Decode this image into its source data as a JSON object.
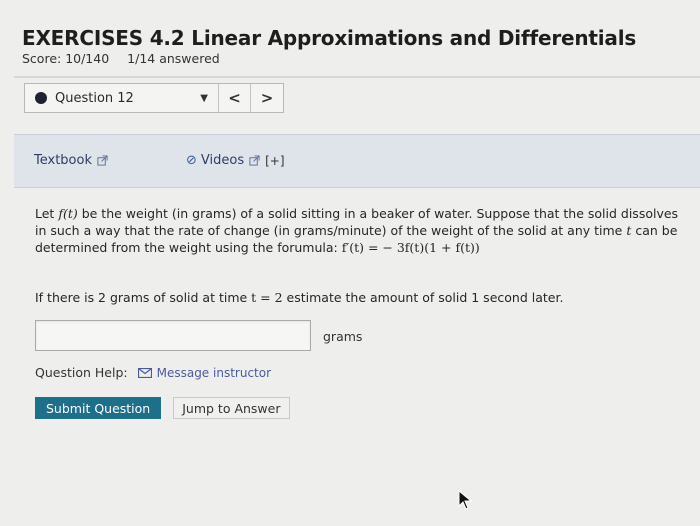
{
  "header": {
    "title": "EXERCISES 4.2 Linear Approximations and Differentials",
    "score": "Score: 10/140",
    "answered": "1/14 answered"
  },
  "question_nav": {
    "selected": "Question 12",
    "prev_label": "<",
    "next_label": ">"
  },
  "resources": {
    "textbook_label": "Textbook",
    "videos_label": "Videos",
    "expand_label": "[+]"
  },
  "problem": {
    "part1": "Let ",
    "fn": "f(t)",
    "part2": " be the weight (in grams) of a solid sitting in a beaker of water. Suppose that the solid dissolves in such a way that the rate of change (in grams/minute) of the weight of the solid at any time ",
    "t": "t",
    "part3": " can be determined from the weight using the forumula: ",
    "formula": "f′(t) = − 3f(t)(1 + f(t))",
    "q1": "If there is 2 grams of solid at time ",
    "q_eq": "t = 2",
    "q2": " estimate the amount of solid 1 second later."
  },
  "answer": {
    "value": "",
    "unit": "grams"
  },
  "help": {
    "label": "Question Help:",
    "message_label": "Message instructor"
  },
  "actions": {
    "submit_label": "Submit Question",
    "jump_label": "Jump to Answer"
  }
}
